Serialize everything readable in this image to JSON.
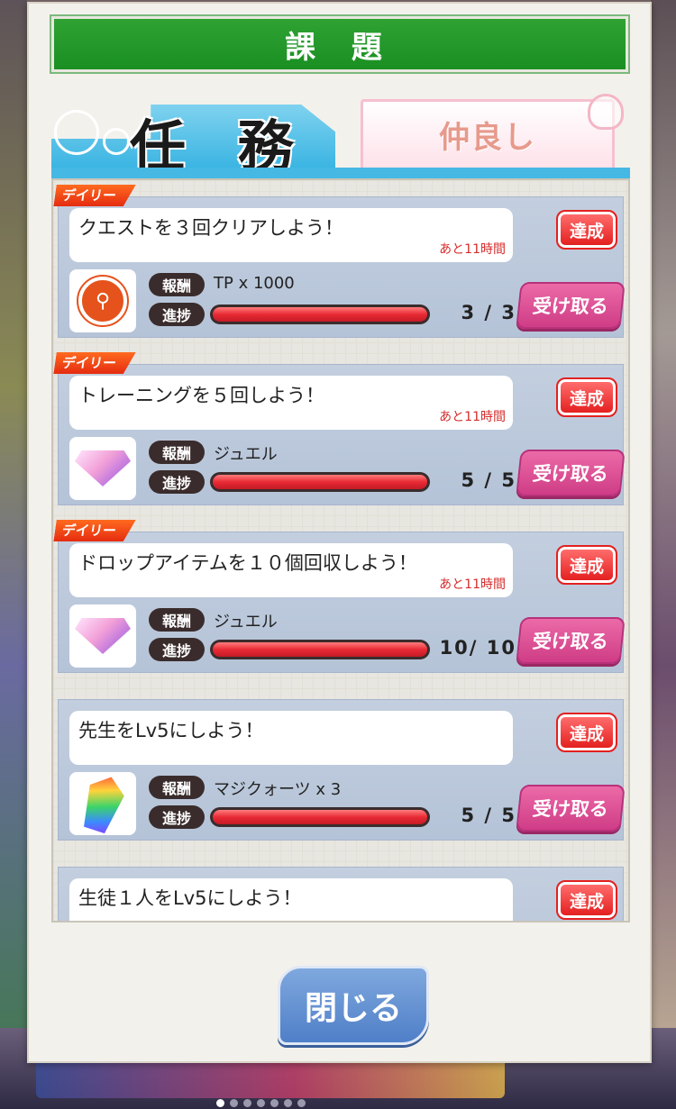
{
  "dialog": {
    "title": "課 題",
    "tabs": {
      "ninmu": "任 務",
      "nakayoshi": "仲良し"
    },
    "close_label": "閉じる"
  },
  "labels": {
    "reward": "報酬",
    "progress": "進捗",
    "done": "達成",
    "claim": "受け取る",
    "daily": "デイリー"
  },
  "colors": {
    "title_green": "#1a8f22",
    "tab_blue": "#39b4e2",
    "done_red": "#e42020",
    "claim_pink": "#cf3d86",
    "close_blue": "#4f7fc8"
  },
  "tasks": [
    {
      "daily": true,
      "name": "クエストを３回クリアしよう！",
      "time_left": "あと11時間",
      "icon": "tp-icon",
      "icon_text": "",
      "reward": "TP x 1000",
      "progress_text": "3 / 3",
      "progress": 1.0
    },
    {
      "daily": true,
      "name": "トレーニングを５回しよう！",
      "time_left": "あと11時間",
      "icon": "jewel-icon",
      "reward": "ジュエル",
      "progress_text": "5 / 5",
      "progress": 1.0
    },
    {
      "daily": true,
      "name": "ドロップアイテムを１０個回収しよう！",
      "time_left": "あと11時間",
      "icon": "jewel-icon",
      "reward": "ジュエル",
      "progress_text": "10/ 10",
      "progress": 1.0
    },
    {
      "daily": false,
      "name": "先生をLv5にしよう！",
      "time_left": "",
      "icon": "crystal-icon",
      "reward": "マジクォーツ x 3",
      "progress_text": "5 / 5",
      "progress": 1.0
    },
    {
      "daily": false,
      "name": "生徒１人をLv5にしよう！",
      "time_left": "",
      "icon": "",
      "reward": "",
      "progress_text": "",
      "progress": 1.0
    }
  ]
}
